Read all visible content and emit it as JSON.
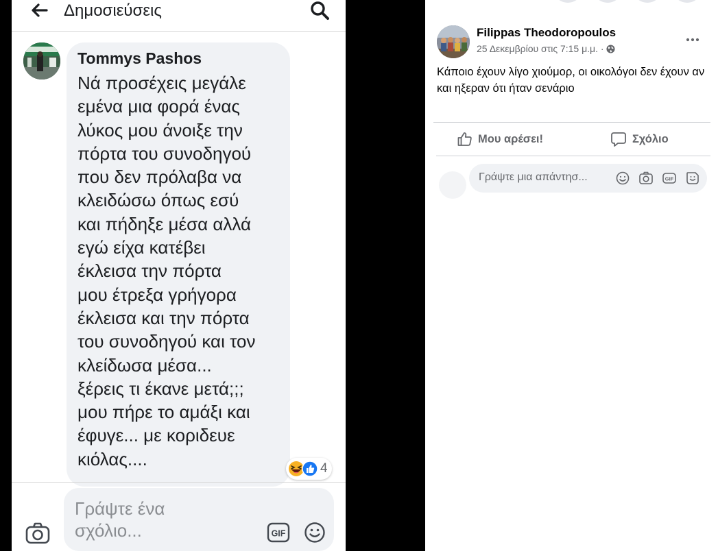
{
  "mobile": {
    "header_title": "Δημοσιεύσεις",
    "comment": {
      "author": "Tommys Pashos",
      "text": "Νά προσέχεις μεγάλε\nεμένα μια φορά ένας\nλύκος μου άνοιξε την\nπόρτα του συνοδηγού\nπου δεν πρόλαβα να\nκλειδώσω όπως εσύ\nκαι πήδηξε μέσα αλλά\nεγώ είχα κατέβει\nέκλεισα την πόρτα\nμου έτρεξα γρήγορα\nέκλεισα και την πόρτα\nτου συνοδηγού και τον\nκλείδωσα μέσα...\nξέρεις τι έκανε μετά;;;\nμου πήρε το αμάξι και\nέφυγε... με κοριδευε\nκιόλας....",
      "reactions": [
        "haha",
        "like"
      ],
      "reaction_count": "4"
    },
    "composer": {
      "placeholder": "Γράψτε ένα σχόλιο...",
      "gif_label": "GIF"
    }
  },
  "desktop": {
    "post": {
      "author": "Filippas Theodoropoulos",
      "timestamp": "25 Δεκεμβρίου στις 7:15 μ.μ. ·",
      "privacy_icon": "globe-icon",
      "body": "Κάποιο έχουν λίγο χιούμορ, οι οικολόγοι δεν έχουν αν και ηξεραν ότι ήταν σενάριο"
    },
    "actions": {
      "like_label": "Μου αρέσει!",
      "comment_label": "Σχόλιο"
    },
    "reply": {
      "placeholder": "Γράψτε μια απάντησ...",
      "gif_label": "GIF"
    }
  },
  "colors": {
    "like_blue": "#1877f2",
    "haha_yellow": "#f7b125",
    "bubble_gray": "#f0f2f5",
    "secondary_text": "#65676b"
  }
}
